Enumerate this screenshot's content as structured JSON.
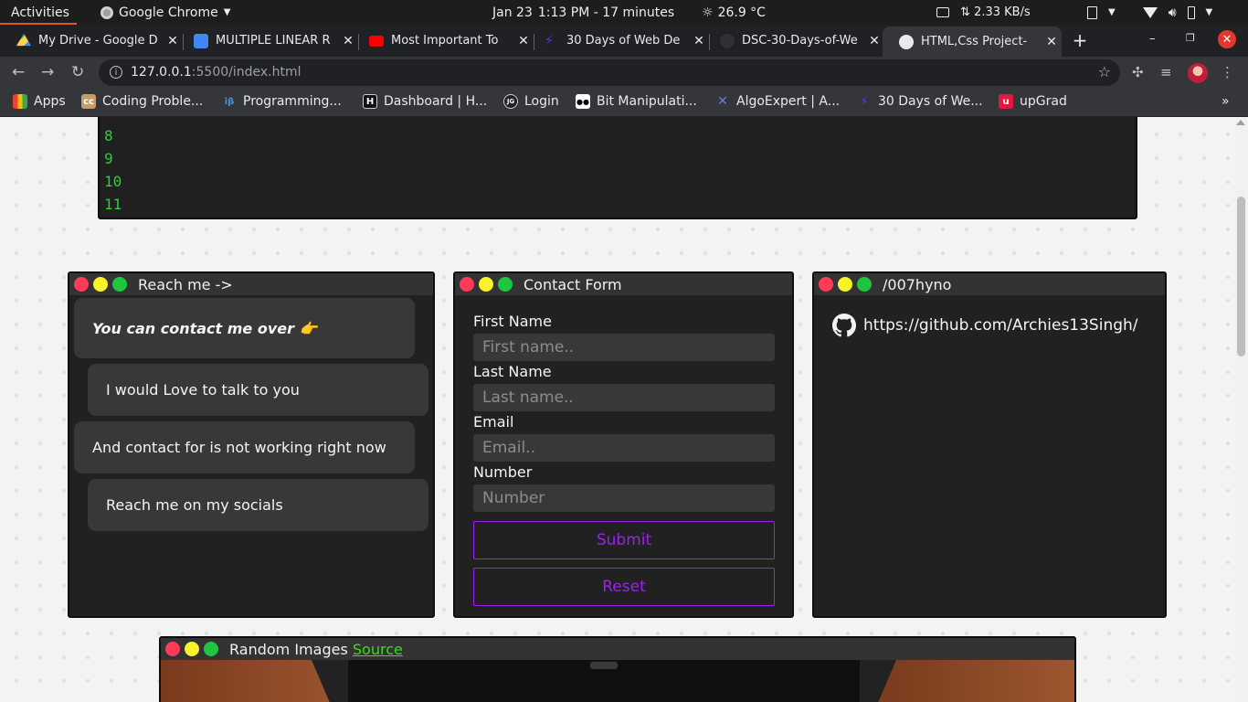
{
  "system_bar": {
    "activities": "Activities",
    "app_name": "Google Chrome",
    "date": "Jan 23",
    "time": "1:13 PM - 17 minutes",
    "weather": "26.9 °C",
    "net_speed": "2.33 KB/s"
  },
  "tabs": [
    {
      "title": "My Drive - Google D",
      "color": "#1fa463"
    },
    {
      "title": "MULTIPLE LINEAR R",
      "color": "#4285f4"
    },
    {
      "title": "Most Important To",
      "color": "#ff0000"
    },
    {
      "title": "30 Days of Web De",
      "color": "#5a31f4"
    },
    {
      "title": "DSC-30-Days-of-We",
      "color": "#303030"
    },
    {
      "title": "HTML,Css Project-",
      "color": "#e8eaed"
    }
  ],
  "address_bar": {
    "host": "127.0.0.1",
    "path": ":5500/index.html"
  },
  "bookmarks": [
    {
      "label": "Apps",
      "icon": "apps-grid-icon",
      "color": "#ea4335"
    },
    {
      "label": "Coding Proble...",
      "icon": "cc",
      "color": "#c69c6d"
    },
    {
      "label": "Programming...",
      "icon": "iβ",
      "color": "#4a90d9"
    },
    {
      "label": "Dashboard | H...",
      "icon": "H",
      "color": "#111111"
    },
    {
      "label": "Login",
      "icon": "JG",
      "color": "#202124"
    },
    {
      "label": "Bit Manipulati...",
      "icon": "●●",
      "color": "#000000"
    },
    {
      "label": "AlgoExpert | A...",
      "icon": "✕",
      "color": "#3b4a9a"
    },
    {
      "label": "30 Days of We...",
      "icon": "⚡",
      "color": "#5a31f4"
    },
    {
      "label": "upGrad",
      "icon": "u",
      "color": "#e5173f"
    }
  ],
  "code_panel": {
    "lines": [
      "8",
      "9",
      "10",
      "11"
    ]
  },
  "reach_window": {
    "title": "Reach me ->",
    "messages": [
      "You can contact me over 👉",
      "I would Love to talk to you",
      "And contact for is not working right now",
      "Reach me on my socials"
    ]
  },
  "contact_form": {
    "title": "Contact Form",
    "first_name_label": "First Name",
    "first_name_placeholder": "First name..",
    "last_name_label": "Last  Name",
    "last_name_placeholder": "Last name..",
    "email_label": "Email",
    "email_placeholder": "Email..",
    "number_label": "Number",
    "number_placeholder": "Number",
    "submit_label": "Submit",
    "reset_label": "Reset"
  },
  "github_window": {
    "title": "/007hyno",
    "link": "https://github.com/Archies13Singh/"
  },
  "images_window": {
    "title": "Random Images",
    "source_link": "Source"
  }
}
